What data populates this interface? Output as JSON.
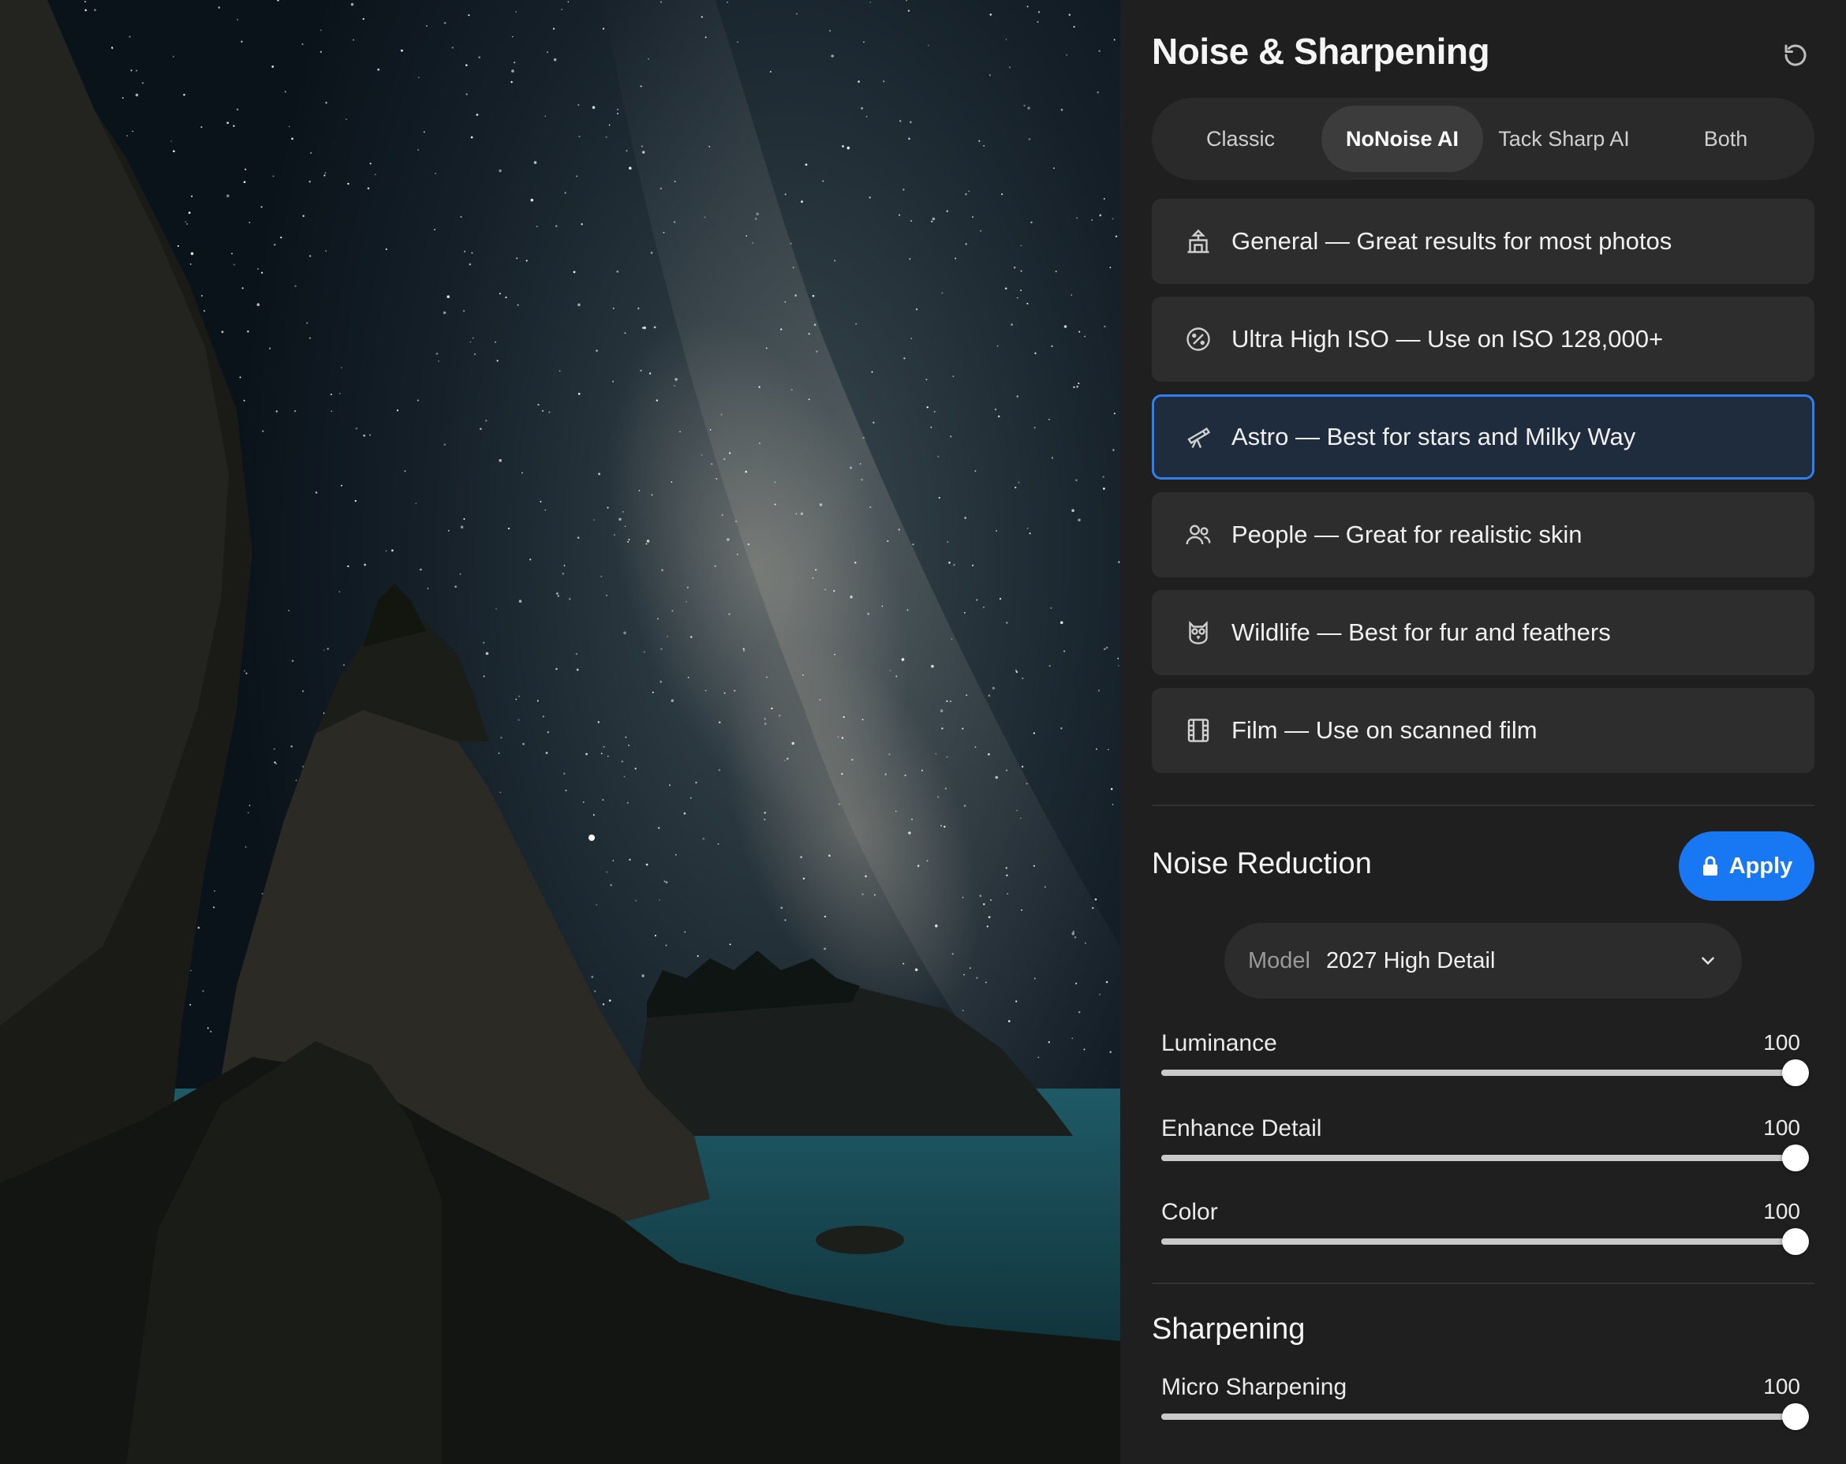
{
  "panel": {
    "title": "Noise & Sharpening",
    "tabs": [
      {
        "label": "Classic",
        "active": false
      },
      {
        "label": "NoNoise AI",
        "active": true
      },
      {
        "label": "Tack Sharp AI",
        "active": false
      },
      {
        "label": "Both",
        "active": false
      }
    ],
    "presets": [
      {
        "icon": "building-icon",
        "label": "General — Great results for most photos",
        "selected": false
      },
      {
        "icon": "iso-dial-icon",
        "label": "Ultra High ISO — Use on ISO 128,000+",
        "selected": false
      },
      {
        "icon": "telescope-icon",
        "label": "Astro — Best for stars and Milky Way",
        "selected": true
      },
      {
        "icon": "people-icon",
        "label": "People — Great for realistic skin",
        "selected": false
      },
      {
        "icon": "owl-icon",
        "label": "Wildlife — Best for fur and feathers",
        "selected": false
      },
      {
        "icon": "film-icon",
        "label": "Film — Use on scanned film",
        "selected": false
      }
    ]
  },
  "noise_reduction": {
    "title": "Noise Reduction",
    "apply_label": "Apply",
    "model_key": "Model",
    "model_value": "2027 High Detail",
    "sliders": [
      {
        "label": "Luminance",
        "value": 100,
        "max": 100
      },
      {
        "label": "Enhance Detail",
        "value": 100,
        "max": 100
      },
      {
        "label": "Color",
        "value": 100,
        "max": 100
      }
    ]
  },
  "sharpening": {
    "title": "Sharpening",
    "sliders": [
      {
        "label": "Micro Sharpening",
        "value": 100,
        "max": 100
      }
    ]
  },
  "colors": {
    "accent": "#1877f2",
    "selected_border": "#2f7ff0",
    "panel_bg": "#1f1f1f"
  }
}
